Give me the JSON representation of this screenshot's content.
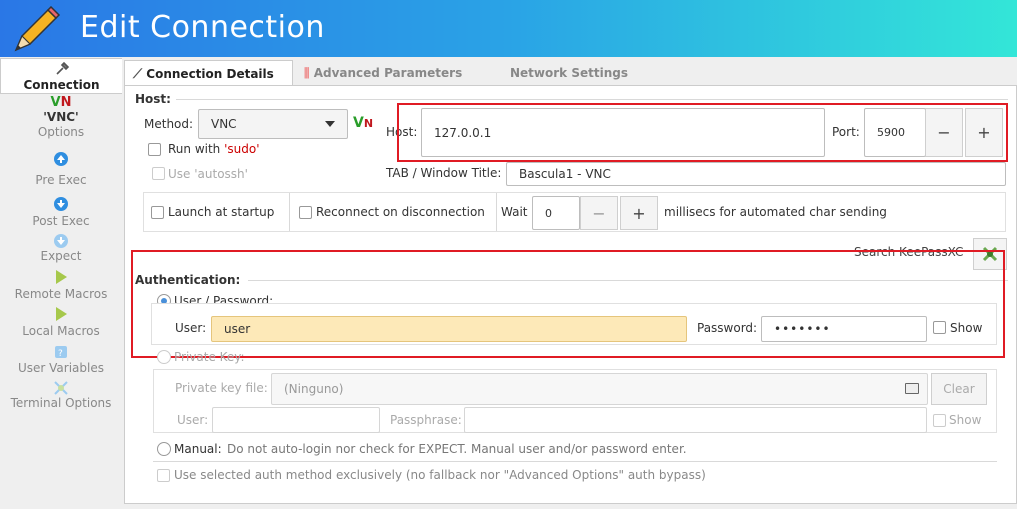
{
  "window": {
    "title": "Edit Connection"
  },
  "sidebar": {
    "items": [
      {
        "label": "Connection",
        "icon": "plug-icon",
        "active": true
      },
      {
        "label": "'VNC'",
        "label2": "Options",
        "icon": "vnc-icon"
      },
      {
        "label": "Pre Exec",
        "icon": "arrow-up-icon"
      },
      {
        "label": "Post Exec",
        "icon": "arrow-down-icon"
      },
      {
        "label": "Expect",
        "icon": "arrow-down-light-icon"
      },
      {
        "label": "Remote Macros",
        "icon": "play-icon"
      },
      {
        "label": "Local Macros",
        "icon": "play-icon"
      },
      {
        "label": "User Variables",
        "icon": "variable-icon"
      },
      {
        "label": "Terminal Options",
        "icon": "terminal-options-icon"
      }
    ]
  },
  "tabs": [
    {
      "label": "Connection Details",
      "icon": "plug-icon",
      "active": true
    },
    {
      "label": "Advanced Parameters",
      "icon": "sliders-icon"
    },
    {
      "label": "Network Settings"
    }
  ],
  "host_section": {
    "title": "Host:",
    "method_label": "Method:",
    "method_value": "VNC",
    "run_with_prefix": "Run with ",
    "run_with_sudo": "'sudo'",
    "use_autossh": "Use 'autossh'",
    "host_label": "Host:",
    "host_value": "127.0.0.1",
    "port_label": "Port:",
    "port_value": "5900",
    "minus": "−",
    "plus": "+",
    "tab_title_label": "TAB / Window Title:",
    "tab_title_value": "Bascula1 - VNC",
    "launch_at_startup": "Launch at startup",
    "reconnect": "Reconnect on disconnection",
    "wait_label": "Wait",
    "wait_value": "0",
    "millisecs": "millisecs for automated char sending",
    "vnc_badge_v": "V",
    "vnc_badge_n": "N"
  },
  "auth": {
    "search_keepass": "Search KeePassXC",
    "title": "Authentication:",
    "user_password_label": "User / Password:",
    "user_label": "User:",
    "user_value": "user",
    "password_label": "Password:",
    "password_value": "•••••••",
    "show": "Show",
    "private_key_label": "Private Key:",
    "private_key_file_label": "Private key file:",
    "private_key_file_value": "(Ninguno)",
    "clear": "Clear",
    "pk_user_label": "User:",
    "passphrase_label": "Passphrase:",
    "pk_show": "Show",
    "manual_label": "Manual:",
    "manual_desc": "Do not auto-login nor check for EXPECT. Manual user and/or password enter.",
    "exclusive": "Use selected auth method exclusively (no fallback nor \"Advanced Options\" auth bypass)"
  },
  "colors": {
    "accent": "#2a77e6",
    "highlight_box": "#e01b24",
    "sudo_red": "#cc0000"
  }
}
